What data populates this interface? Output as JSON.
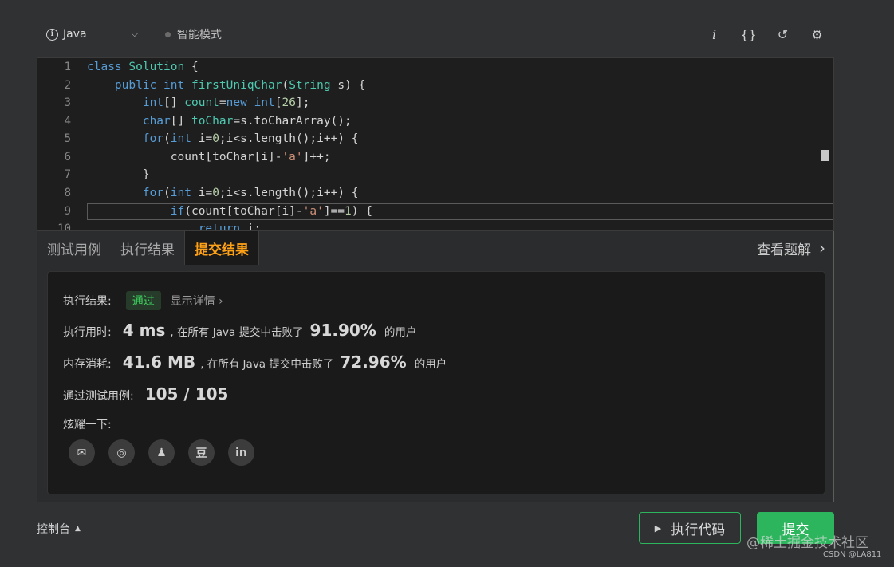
{
  "toolbar": {
    "language": "Java",
    "mode_label": "智能模式",
    "icons": [
      "info-icon",
      "braces-icon",
      "undo-icon",
      "settings-icon"
    ],
    "icon_glyphs": {
      "info": "i",
      "braces": "{}",
      "undo": "↺",
      "settings": "⚙"
    }
  },
  "editor": {
    "line_numbers": [
      "1",
      "2",
      "3",
      "4",
      "5",
      "6",
      "7",
      "8",
      "9",
      "10"
    ]
  },
  "tabs": {
    "test_case": "测试用例",
    "run_result": "执行结果",
    "submit_result": "提交结果",
    "view_solution": "查看题解"
  },
  "result": {
    "status_label": "执行结果:",
    "status_value": "通过",
    "detail_link": "显示详情 ›",
    "runtime_label": "执行用时:",
    "runtime_value": "4 ms",
    "runtime_mid": ", 在所有 Java 提交中击败了",
    "runtime_pct": "91.90%",
    "runtime_suffix": "的用户",
    "memory_label": "内存消耗:",
    "memory_value": "41.6 MB",
    "memory_mid": ", 在所有 Java 提交中击败了",
    "memory_pct": "72.96%",
    "memory_suffix": "的用户",
    "cases_label": "通过测试用例:",
    "cases_value": "105 / 105",
    "share_label": "炫耀一下:",
    "share_icons": [
      "wechat-icon",
      "weibo-icon",
      "qq-icon",
      "douban-icon",
      "linkedin-icon"
    ],
    "share_glyphs": {
      "wechat": "✉",
      "weibo": "◎",
      "qq": "♟",
      "douban": "豆",
      "linkedin": "in"
    }
  },
  "footer": {
    "console_label": "控制台",
    "run_label": "执行代码",
    "submit_label": "提交",
    "watermark": "@稀土掘金技术社区",
    "watermark_small": "CSDN @LA811"
  },
  "colors": {
    "accent_orange": "#ffa116",
    "success_green": "#2db55d",
    "pass_text": "#3ed15f"
  }
}
